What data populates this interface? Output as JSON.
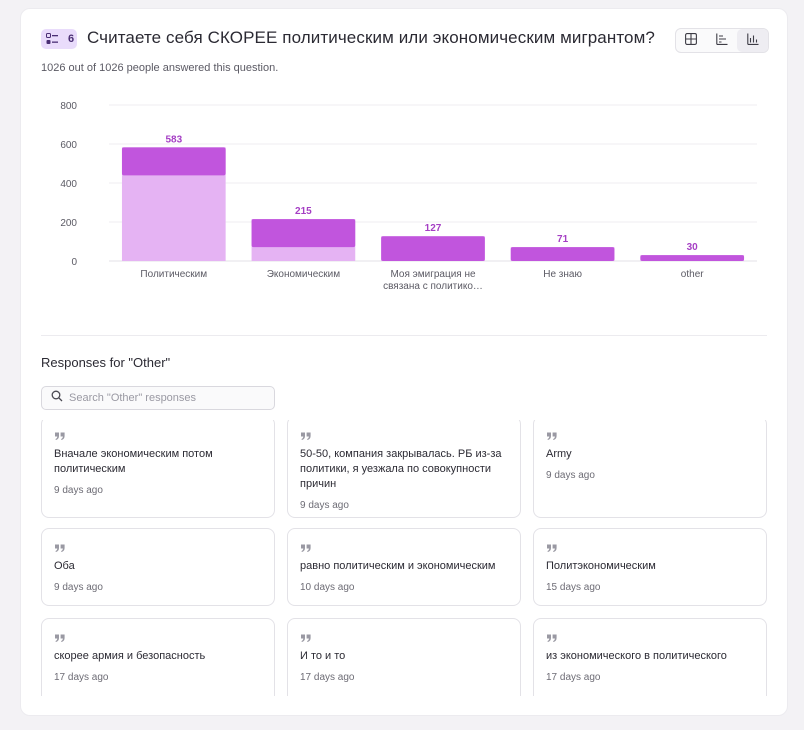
{
  "question": {
    "number": "6",
    "title": "Считаете себя СКОРЕЕ политическим или экономическим мигрантом?",
    "answered": "1026 out of 1026 people answered this question."
  },
  "view_toggle": {
    "options": [
      "table-icon",
      "horizontal-bar-icon",
      "vertical-bar-icon"
    ],
    "active": "vertical-bar-icon"
  },
  "colors": {
    "bar_top": "#c155dd",
    "bar_body": "#e5b3f3",
    "value_label": "#a53fc4",
    "grid": "#efeef2",
    "tick": "#5b5a64",
    "accent_badge": "#e9dcfb"
  },
  "chart_data": {
    "type": "bar",
    "categories": [
      "Политическим",
      "Экономическим",
      "Моя эмиграция не связана с политико…",
      "Не знаю",
      "other"
    ],
    "category_lines": [
      [
        "Политическим"
      ],
      [
        "Экономическим"
      ],
      [
        "Моя эмиграция не",
        "связана с политико…"
      ],
      [
        "Не знаю"
      ],
      [
        "other"
      ]
    ],
    "values": [
      583,
      215,
      127,
      71,
      30
    ],
    "value_labels": [
      "583",
      "215",
      "127",
      "71",
      "30"
    ],
    "yticks": [
      0,
      200,
      400,
      600,
      800
    ],
    "ylim": [
      0,
      800
    ],
    "grid": true,
    "title": "",
    "xlabel": "",
    "ylabel": ""
  },
  "responses": {
    "title": "Responses for \"Other\"",
    "search_placeholder": "Search \"Other\" responses",
    "items": [
      {
        "text": "Вначале экономическим потом политическим",
        "time": "9 days ago"
      },
      {
        "text": "50-50, компания закрывалась. РБ из-за политики, я уезжала по совокупности причин",
        "time": "9 days ago"
      },
      {
        "text": "Army",
        "time": "9 days ago"
      },
      {
        "text": "Оба",
        "time": "9 days ago"
      },
      {
        "text": "равно политическим и экономическим",
        "time": "10 days ago"
      },
      {
        "text": "Политэкономическим",
        "time": "15 days ago"
      },
      {
        "text": "скорее армия и безопасность",
        "time": "17 days ago"
      },
      {
        "text": "И то и то",
        "time": "17 days ago"
      },
      {
        "text": "из экономического в политического",
        "time": "17 days ago"
      }
    ]
  }
}
